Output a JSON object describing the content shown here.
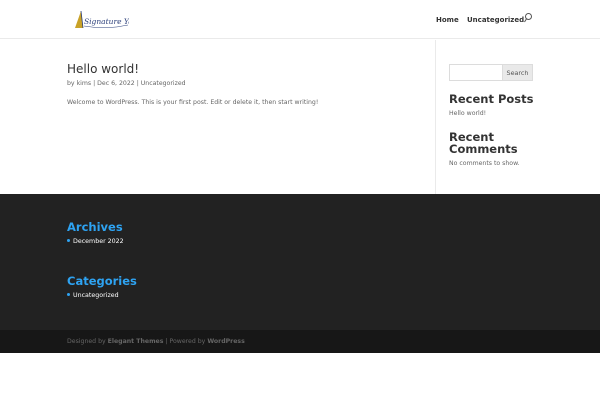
{
  "header": {
    "logo_text": "Signature Yachts",
    "nav": [
      {
        "label": "Home"
      },
      {
        "label": "Uncategorized"
      }
    ]
  },
  "post": {
    "title": "Hello world!",
    "meta": {
      "by": "by",
      "author": "kims",
      "sep1": "|",
      "date": "Dec 6, 2022",
      "sep2": "|",
      "category": "Uncategorized"
    },
    "excerpt": "Welcome to WordPress. This is your first post. Edit or delete it, then start writing!"
  },
  "sidebar": {
    "search_button": "Search",
    "recent_posts_heading": "Recent Posts",
    "recent_posts": [
      "Hello world!"
    ],
    "recent_comments_heading": "Recent Comments",
    "recent_comments_empty": "No comments to show."
  },
  "footer": {
    "archives_heading": "Archives",
    "archives": [
      "December 2022"
    ],
    "categories_heading": "Categories",
    "categories": [
      "Uncategorized"
    ]
  },
  "bottom_bar": {
    "designed_by": "Designed by",
    "elegant_themes": "Elegant Themes",
    "powered_by": "| Powered by",
    "wordpress": "WordPress"
  },
  "colors": {
    "accent": "#2ea3f2",
    "footer_bg": "#222222",
    "bottom_bar_bg": "#171717"
  }
}
